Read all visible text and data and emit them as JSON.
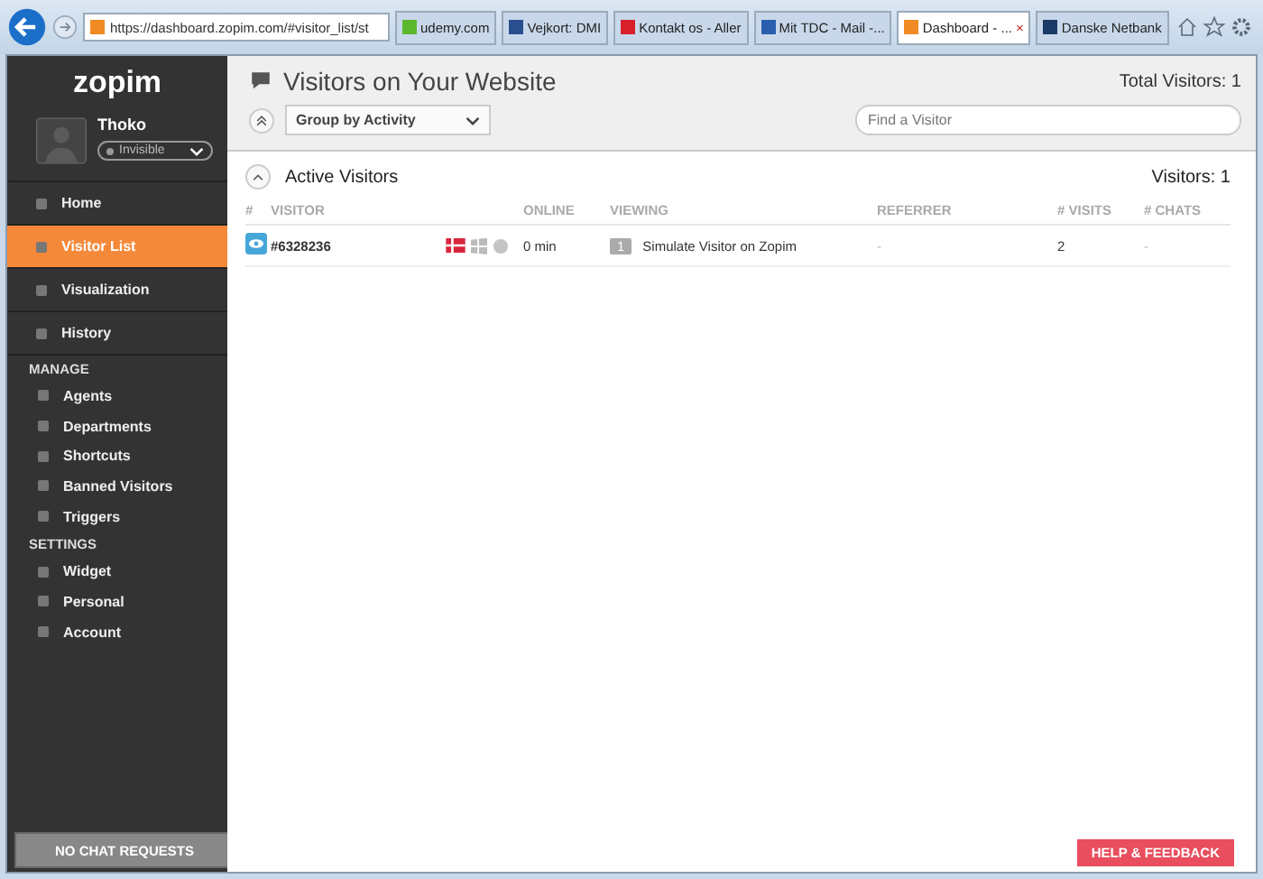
{
  "browser": {
    "address": "https://dashboard.zopim.com/#visitor_list/st",
    "tabs": [
      {
        "label": "udemy.com",
        "selected": false,
        "color": "#5cb82e"
      },
      {
        "label": "Vejkort: DMI",
        "selected": false,
        "color": "#2a4f8f"
      },
      {
        "label": "Kontakt os - Aller",
        "selected": false,
        "color": "#d8202a"
      },
      {
        "label": "Mit TDC - Mail -...",
        "selected": false,
        "color": "#2a5fb0"
      },
      {
        "label": "Dashboard - ...",
        "selected": true,
        "color": "#f08a24"
      },
      {
        "label": "Danske Netbank",
        "selected": false,
        "color": "#1c3a66"
      }
    ],
    "close_tab": "×"
  },
  "sidebar": {
    "logo": "zopim",
    "user": {
      "name": "Thoko",
      "status": "Invisible"
    },
    "main_nav": [
      {
        "label": "Home",
        "selected": false
      },
      {
        "label": "Visitor List",
        "selected": true
      },
      {
        "label": "Visualization",
        "selected": false
      },
      {
        "label": "History",
        "selected": false
      }
    ],
    "sections": [
      {
        "title": "MANAGE",
        "items": [
          "Agents",
          "Departments",
          "Shortcuts",
          "Banned Visitors",
          "Triggers"
        ]
      },
      {
        "title": "SETTINGS",
        "items": [
          "Widget",
          "Personal",
          "Account"
        ]
      }
    ],
    "chat_requests": "NO CHAT REQUESTS"
  },
  "main": {
    "title": "Visitors on Your Website",
    "total": "Total Visitors: 1",
    "group_by": "Group by Activity",
    "search": {
      "placeholder": "Find a Visitor"
    },
    "group": {
      "title": "Active Visitors",
      "count": "Visitors: 1",
      "expanded": true,
      "columns": [
        "#",
        "VISITOR",
        "ONLINE",
        "VIEWING",
        "REFERRER",
        "# VISITS",
        "# CHATS"
      ],
      "rows": [
        {
          "visitor": "#6328236",
          "online": "0 min",
          "page_count": "1",
          "viewing": "Simulate Visitor on Zopim",
          "referrer": "-",
          "visits": "2",
          "chats": "-"
        }
      ]
    }
  },
  "help_button": "HELP & FEEDBACK"
}
